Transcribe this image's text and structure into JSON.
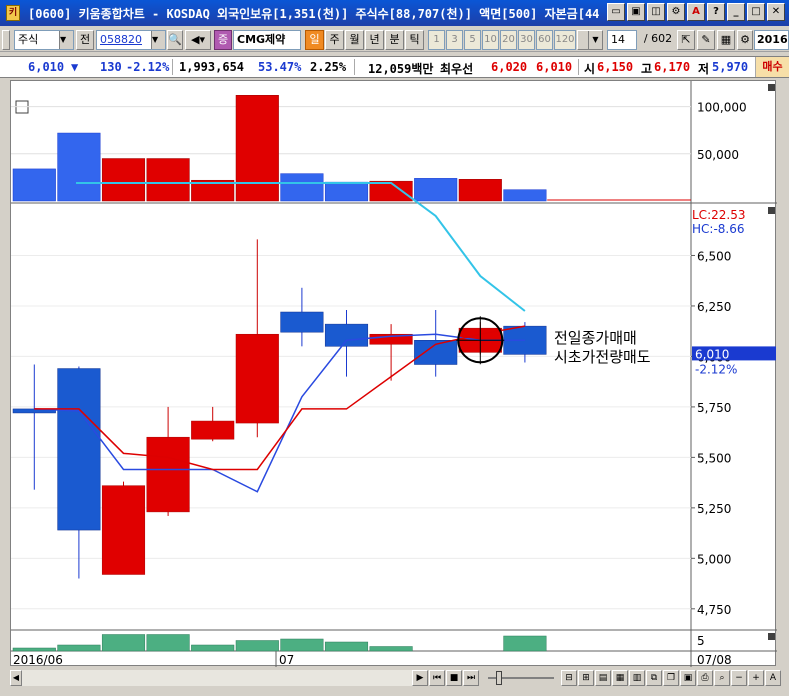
{
  "window": {
    "title": "[0600] 키움종합차트 - KOSDAQ 외국인보유[1,351(천)] 주식수[88,707(천)] 액면[500] 자본금[44",
    "app_icon": "키"
  },
  "toolbar": {
    "market_type": "주식",
    "prefix_label": "전",
    "stock_code": "058820",
    "stock_name": "CMG제약",
    "badge_jeung": "증",
    "periods": [
      "일",
      "주",
      "월",
      "년",
      "분",
      "틱"
    ],
    "minute_options": [
      "1",
      "3",
      "5",
      "10",
      "20",
      "30",
      "60",
      "120"
    ],
    "count_value": "14",
    "count_total": "/ 602",
    "date_label": "2016"
  },
  "pricebar": {
    "price": "6,010",
    "change_arrow": "▼",
    "change": "130",
    "change_pct": "-2.12%",
    "volume": "1,993,654",
    "volume_pct": "53.47%",
    "turnover_pct": "2.25%",
    "amount": "12,059백만",
    "best_label": "최우선",
    "best_ask": "6,020",
    "best_bid": "6,010",
    "open_label": "시",
    "open": "6,150",
    "high_label": "고",
    "high": "6,170",
    "low_label": "저",
    "low": "5,970",
    "sell_tag": "매수"
  },
  "chart_data": {
    "type": "candlestick",
    "volume_axis": [
      "100,000",
      "50,000"
    ],
    "price_axis": [
      "6,500",
      "6,250",
      "6,000",
      "5,750",
      "5,500",
      "5,250",
      "5,000",
      "4,750"
    ],
    "indicator_axis": [
      "5"
    ],
    "lc_label": "LC:22.53",
    "hc_label": "HC:-8.66",
    "current_price_label": "6,010",
    "current_pct_label": "-2.12%",
    "annotation_line1": "전일종가매매",
    "annotation_line2": "시초가전량매도",
    "x_labels": [
      "2016/06",
      "07",
      "07/08"
    ],
    "candles": [
      {
        "o": 5740,
        "c": 5720,
        "h": 5960,
        "l": 5340
      },
      {
        "o": 5940,
        "c": 5140,
        "h": 5950,
        "l": 4900
      },
      {
        "o": 4920,
        "c": 5360,
        "h": 5380,
        "l": 4920
      },
      {
        "o": 5230,
        "c": 5600,
        "h": 5750,
        "l": 5210
      },
      {
        "o": 5590,
        "c": 5680,
        "h": 5750,
        "l": 5580
      },
      {
        "o": 5670,
        "c": 6110,
        "h": 6580,
        "l": 5600
      },
      {
        "o": 6220,
        "c": 6120,
        "h": 6340,
        "l": 6050
      },
      {
        "o": 6160,
        "c": 6050,
        "h": 6230,
        "l": 5900
      },
      {
        "o": 6060,
        "c": 6110,
        "h": 6160,
        "l": 5880
      },
      {
        "o": 6080,
        "c": 5960,
        "h": 6230,
        "l": 5900
      },
      {
        "o": 6020,
        "c": 6140,
        "h": 6170,
        "l": 6010
      },
      {
        "o": 6150,
        "c": 6010,
        "h": 6170,
        "l": 5970
      }
    ],
    "volumes": [
      34000,
      72000,
      45000,
      45000,
      22000,
      112000,
      29000,
      20000,
      21000,
      24000,
      23000,
      12000
    ],
    "ma_red": [
      5740,
      5740,
      5520,
      5500,
      5440,
      5440,
      5740,
      5740,
      5900,
      6060,
      6110,
      6150
    ],
    "ma_blue": [
      5740,
      5730,
      5440,
      5440,
      5440,
      5330,
      5800,
      6080,
      6100,
      6110,
      6080,
      6080
    ],
    "cyan_line": [
      null,
      102,
      102,
      102,
      102,
      102,
      102,
      102,
      102,
      135,
      195,
      230
    ],
    "indicator_bars": [
      2,
      4,
      11,
      11,
      4,
      7,
      8,
      6,
      3,
      0,
      0,
      10
    ]
  }
}
